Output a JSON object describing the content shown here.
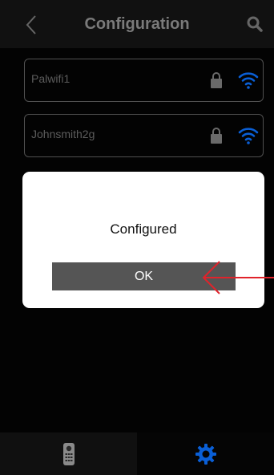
{
  "header": {
    "title": "Configuration"
  },
  "wifi_networks": [
    {
      "name": "Palwifi1"
    },
    {
      "name": "Johnsmith2g"
    }
  ],
  "dialog": {
    "message": "Configured",
    "ok_label": "OK"
  },
  "icons": {
    "back": "chevron-left-icon",
    "search": "search-icon",
    "lock": "lock-icon",
    "wifi": "wifi-icon",
    "remote": "remote-control-icon",
    "settings": "gear-icon"
  },
  "colors": {
    "accent_blue": "#0a5fd6",
    "annotation_red": "#e0232b",
    "ok_button": "#555555"
  }
}
